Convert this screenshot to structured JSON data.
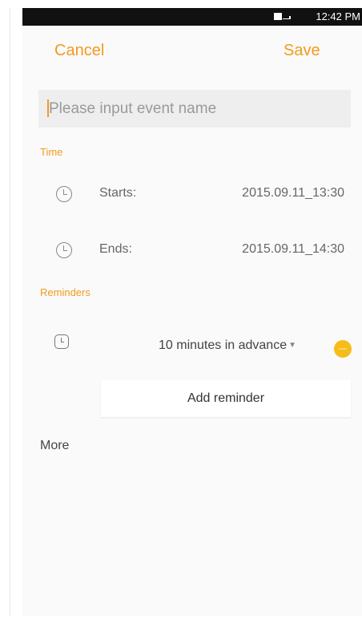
{
  "status_bar": {
    "time": "12:42 PM"
  },
  "header": {
    "cancel_label": "Cancel",
    "save_label": "Save"
  },
  "event_name": {
    "placeholder": "Please input event name",
    "value": ""
  },
  "time_section": {
    "label": "Time",
    "starts_label": "Starts:",
    "starts_value": "2015.09.11_13:30",
    "ends_label": "Ends:",
    "ends_value": "2015.09.11_14:30"
  },
  "reminders_section": {
    "label": "Reminders",
    "reminder_value": "10 minutes in advance",
    "add_reminder_label": "Add reminder"
  },
  "more_label": "More",
  "colors": {
    "accent": "#f39a1c",
    "remove_button": "#f5bc1b"
  }
}
